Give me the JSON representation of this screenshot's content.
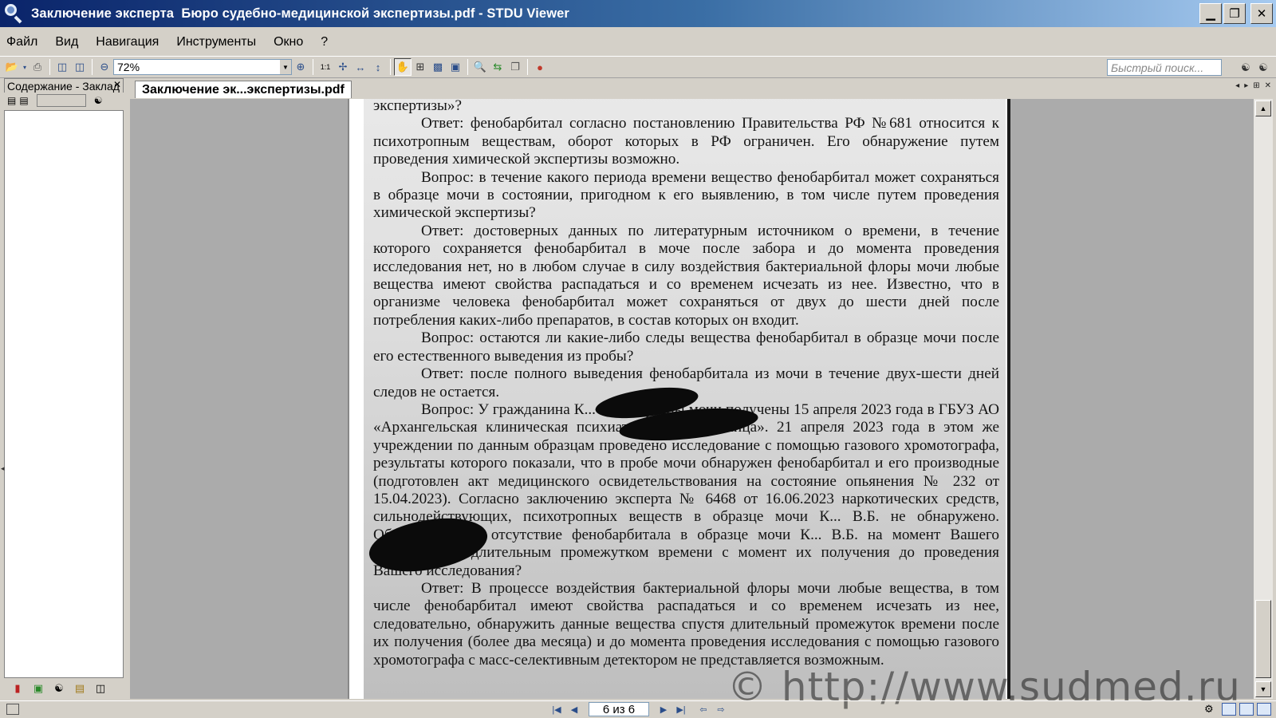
{
  "window": {
    "title": "Заключение эксперта  Бюро судебно-медицинской экспертизы.pdf - STDU Viewer",
    "minimize": "▁",
    "maximize": "❐",
    "close": "✕"
  },
  "menu": [
    "Файл",
    "Вид",
    "Навигация",
    "Инструменты",
    "Окно",
    "?"
  ],
  "toolbar": {
    "zoom_value": "72%",
    "search_placeholder": "Быстрый поиск..."
  },
  "left_panel": {
    "tab_label": "Содержание - Заклад",
    "close_glyph": "✕"
  },
  "document": {
    "tab_label": "Заключение эк...экспертизы.pdf",
    "paragraphs": [
      {
        "text": "экспертизы»?",
        "indent": false
      },
      {
        "text": "Ответ: фенобарбитал согласно постановлению Правительства РФ №681 относится к психотропным веществам, оборот которых в РФ ограничен. Его обнаружение путем проведения химической экспертизы возможно.",
        "indent": true
      },
      {
        "text": "Вопрос: в течение какого периода времени вещество фенобарбитал может сохраняться в образце мочи в состоянии, пригодном к его выявлению, в том числе путем проведения химической экспертизы?",
        "indent": true
      },
      {
        "text": "Ответ: достоверных данных по литературным источником о времени, в течение которого сохраняется фенобарбитал в моче после забора и до момента проведения исследования нет, но в любом случае в силу воздействия бактериальной флоры мочи любые вещества имеют свойства распадаться и со временем исчезать из нее. Известно, что в организме человека фенобарбитал может сохраняться от двух до шести дней после потребления каких-либо препаратов, в состав которых он входит.",
        "indent": true
      },
      {
        "text": "Вопрос: остаются ли какие-либо следы вещества фенобарбитал в образце мочи после его естественного выведения из пробы?",
        "indent": true
      },
      {
        "text": "Ответ: после полного выведения фенобарбитала из мочи в течение двух-шести дней следов не остается.",
        "indent": true
      },
      {
        "text": "Вопрос: У гражданина К... В.Б. образцы мочи получены 15 апреля 2023 года в ГБУЗ АО «Архангельская клиническая психиатрическая больница». 21 апреля 2023 года в этом же учреждении по данным образцам проведено исследование с помощью газового хромотографа, результаты которого показали, что в пробе мочи обнаружен фенобарбитал и его производные (подготовлен акт медицинского освидетельствования на состояние опьянения № 232 от 15.04.2023). Согласно заключению эксперта № 6468 от 16.06.2023 наркотических средств, сильнодействующих, психотропных веществ в образце мочи К... В.Б. не обнаружено. Объясняется ли отсутствие фенобарбитала в образце мочи К... В.Б. на момент Вашего исследования длительным промежутком времени с момент их получения до проведения Вашего исследования?",
        "indent": true
      },
      {
        "text": "Ответ: В процессе воздействия бактериальной флоры мочи любые вещества, в том числе фенобарбитал имеют свойства распадаться и со временем исчезать из нее, следовательно, обнаружить данные вещества спустя длительный промежуток времени после их получения (более два месяца) и до момента проведения исследования с помощью газового хромотографа с масс-селективным детектором не представляется возможным.",
        "indent": true
      }
    ],
    "watermark": "© http://www.sudmed.ru"
  },
  "status": {
    "page_indicator": "6 из 6"
  }
}
